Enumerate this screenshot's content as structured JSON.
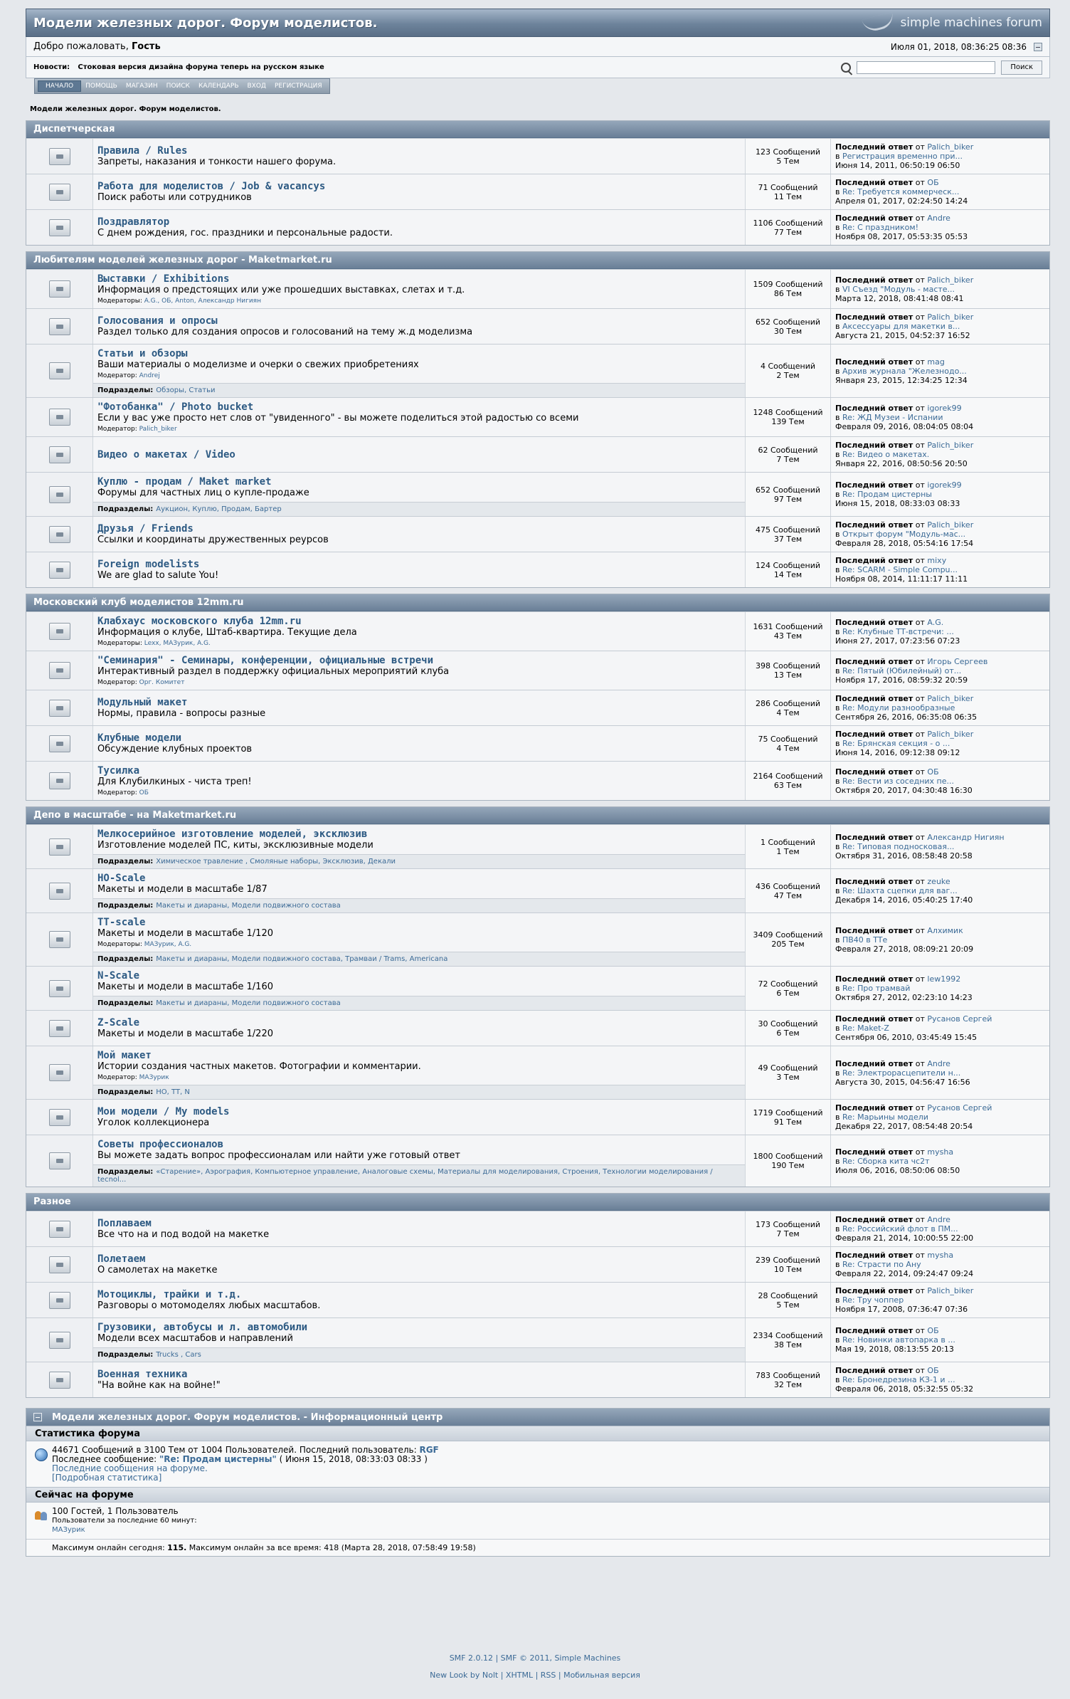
{
  "header": {
    "title": "Модели железных дорог. Форум моделистов.",
    "logo_text": "simple machines forum",
    "welcome_prefix": "Добро пожаловать,",
    "welcome_user": "Гость",
    "datetime": "Июля 01, 2018, 08:36:25 08:36",
    "news_label": "Новости:",
    "news_text": "Стоковая версия дизайна форума теперь на русском языке",
    "search_button": "Поиск",
    "menu": [
      "НАЧАЛО",
      "ПОМОЩЬ",
      "МАГАЗИН",
      "ПОИСК",
      "КАЛЕНДАРЬ",
      "ВХОД",
      "РЕГИСТРАЦИЯ"
    ],
    "breadcrumb": "Модели железных дорог. Форум моделистов."
  },
  "labels": {
    "last_post": "Последний ответ",
    "from": "от",
    "in": "в",
    "subboards": "Подразделы:"
  },
  "categories": [
    {
      "title": "Диспетчерская",
      "boards": [
        {
          "name": "Правила / Rules",
          "desc": "Запреты, наказания и тонкости нашего форума.",
          "posts": "123 Сообщений",
          "topics": "5 Тем",
          "lp_user": "Palich_biker",
          "lp_topic": "Регистрация временно при...",
          "lp_date": "Июня 14, 2011, 06:50:19 06:50",
          "mods_label": "",
          "mods": "",
          "subs": ""
        },
        {
          "name": "Работа для моделистов / Job & vacancys",
          "desc": "Поиск работы или сотрудников",
          "posts": "71 Сообщений",
          "topics": "11 Тем",
          "lp_user": "ОБ",
          "lp_topic": "Re: Требуется коммерческ...",
          "lp_date": "Апреля 01, 2017, 02:24:50 14:24",
          "mods_label": "",
          "mods": "",
          "subs": ""
        },
        {
          "name": "Поздравлятор",
          "desc": "С днем рождения, гос. праздники и персональные радости.",
          "posts": "1106 Сообщений",
          "topics": "77 Тем",
          "lp_user": "Andre",
          "lp_topic": "Re: С праздником!",
          "lp_date": "Ноября 08, 2017, 05:53:35 05:53",
          "mods_label": "",
          "mods": "",
          "subs": ""
        }
      ]
    },
    {
      "title": "Любителям моделей железных дорог - Maketmarket.ru",
      "boards": [
        {
          "name": "Выставки / Exhibitions",
          "desc": "Информация о предстоящих или уже прошедших выставках, слетах и т.д.",
          "posts": "1509 Сообщений",
          "topics": "86 Тем",
          "lp_user": "Palich_biker",
          "lp_topic": "VI Съезд \"Модуль - масте...",
          "lp_date": "Марта 12, 2018, 08:41:48 08:41",
          "mods_label": "Модераторы:",
          "mods": "A.G., ОБ, Anton, Александр Нигиян",
          "subs": ""
        },
        {
          "name": "Голосования и опросы",
          "desc": "Раздел только для создания опросов и голосований на тему ж.д моделизма",
          "posts": "652 Сообщений",
          "topics": "30 Тем",
          "lp_user": "Palich_biker",
          "lp_topic": "Аксессуары для макетки в...",
          "lp_date": "Августа 21, 2015, 04:52:37 16:52",
          "mods_label": "",
          "mods": "",
          "subs": ""
        },
        {
          "name": "Статьи и обзоры",
          "desc": "Ваши материалы о моделизме и очерки о свежих приобретениях",
          "posts": "4 Сообщений",
          "topics": "2 Тем",
          "lp_user": "mag",
          "lp_topic": "Архив журнала \"Железнодо...",
          "lp_date": "Января 23, 2015, 12:34:25 12:34",
          "mods_label": "Модератор:",
          "mods": "Andrej",
          "subs": "Обзоры, Статьи"
        },
        {
          "name": "\"Фотобанка\" / Photo bucket",
          "desc": "Если у вас уже просто нет слов от \"увиденного\" - вы можете поделиться этой радостью со всеми",
          "posts": "1248 Сообщений",
          "topics": "139 Тем",
          "lp_user": "igorek99",
          "lp_topic": "Re: ЖД Музеи - Испании",
          "lp_date": "Февраля 09, 2016, 08:04:05 08:04",
          "mods_label": "Модератор:",
          "mods": "Palich_biker",
          "subs": ""
        },
        {
          "name": "Видео о макетах / Video",
          "desc": "",
          "posts": "62 Сообщений",
          "topics": "7 Тем",
          "lp_user": "Palich_biker",
          "lp_topic": "Re: Видео о макетах.",
          "lp_date": "Января 22, 2016, 08:50:56 20:50",
          "mods_label": "",
          "mods": "",
          "subs": ""
        },
        {
          "name": "Куплю - продам / Maket market",
          "desc": "Форумы для частных лиц о купле-продаже",
          "posts": "652 Сообщений",
          "topics": "97 Тем",
          "lp_user": "igorek99",
          "lp_topic": "Re: Продам цистерны",
          "lp_date": "Июня 15, 2018, 08:33:03 08:33",
          "mods_label": "",
          "mods": "",
          "subs": "Аукцион, Куплю, Продам, Бартер"
        },
        {
          "name": "Друзья / Friends",
          "desc": "Ссылки и координаты дружественных реурсов",
          "posts": "475 Сообщений",
          "topics": "37 Тем",
          "lp_user": "Palich_biker",
          "lp_topic": "Открыт форум \"Модуль-мас...",
          "lp_date": "Февраля 28, 2018, 05:54:16 17:54",
          "mods_label": "",
          "mods": "",
          "subs": ""
        },
        {
          "name": "Foreign modelists",
          "desc": "We are glad to salute You!",
          "posts": "124 Сообщений",
          "topics": "14 Тем",
          "lp_user": "mixy",
          "lp_topic": "Re: SCARM - Simple Compu...",
          "lp_date": "Ноября 08, 2014, 11:11:17 11:11",
          "mods_label": "",
          "mods": "",
          "subs": ""
        }
      ]
    },
    {
      "title": "Московский клуб моделистов 12mm.ru",
      "boards": [
        {
          "name": "Клабхаус московского клуба 12mm.ru",
          "desc": "Информация о клубе, Штаб-квартира. Текущие дела",
          "posts": "1631 Сообщений",
          "topics": "43 Тем",
          "lp_user": "A.G.",
          "lp_topic": "Re: Клубные ТТ-встречи: ...",
          "lp_date": "Июня 27, 2017, 07:23:56 07:23",
          "mods_label": "Модераторы:",
          "mods": "Lexx, МАЗурик, A.G.",
          "subs": ""
        },
        {
          "name": "\"Семинария\" - Семинары, конференции, официальные встречи",
          "desc": "Интерактивный раздел в поддержку официальных мероприятий клуба",
          "posts": "398 Сообщений",
          "topics": "13 Тем",
          "lp_user": "Игорь Сергеев",
          "lp_topic": "Re: Пятый (Юбилейный) от...",
          "lp_date": "Ноября 17, 2016, 08:59:32 20:59",
          "mods_label": "Модератор:",
          "mods": "Орг. Комитет",
          "subs": ""
        },
        {
          "name": "Модульный макет",
          "desc": "Нормы, правила - вопросы разные",
          "posts": "286 Сообщений",
          "topics": "4 Тем",
          "lp_user": "Palich_biker",
          "lp_topic": "Re: Модули разнообразные",
          "lp_date": "Сентября 26, 2016, 06:35:08 06:35",
          "mods_label": "",
          "mods": "",
          "subs": ""
        },
        {
          "name": "Клубные модели",
          "desc": "Обсуждение клубных проектов",
          "posts": "75 Сообщений",
          "topics": "4 Тем",
          "lp_user": "Palich_biker",
          "lp_topic": "Re: Брянская секция - о ...",
          "lp_date": "Июня 14, 2016, 09:12:38 09:12",
          "mods_label": "",
          "mods": "",
          "subs": ""
        },
        {
          "name": "Тусилка",
          "desc": "Для Клубилкиных - чиста треп!",
          "posts": "2164 Сообщений",
          "topics": "63 Тем",
          "lp_user": "ОБ",
          "lp_topic": "Re: Вести из соседних пе...",
          "lp_date": "Октября 20, 2017, 04:30:48 16:30",
          "mods_label": "Модератор:",
          "mods": "ОБ",
          "subs": ""
        }
      ]
    },
    {
      "title": "Депо в масштабе - на Maketmarket.ru",
      "boards": [
        {
          "name": "Мелкосерийное изготовление моделей, эксклюзив",
          "desc": "Изготовление моделей ПС, киты, эксклюзивные модели",
          "posts": "1 Сообщений",
          "topics": "1 Тем",
          "lp_user": "Александр Нигиян",
          "lp_topic": "Re: Типовая подносковая...",
          "lp_date": "Октября 31, 2016, 08:58:48 20:58",
          "mods_label": "",
          "mods": "",
          "subs": "Химическое травление , Смоляные наборы, Эксклюзив, Декали"
        },
        {
          "name": "HO-Scale",
          "desc": "Макеты и модели в масштабе 1/87",
          "posts": "436 Сообщений",
          "topics": "47 Тем",
          "lp_user": "zeuke",
          "lp_topic": "Re: Шахта сцепки для ваг...",
          "lp_date": "Декабря 14, 2016, 05:40:25 17:40",
          "mods_label": "",
          "mods": "",
          "subs": "Макеты и диараны, Модели подвижного состава"
        },
        {
          "name": "TT-scale",
          "desc": "Макеты и модели в масштабе 1/120",
          "posts": "3409 Сообщений",
          "topics": "205 Тем",
          "lp_user": "Алхимик",
          "lp_topic": "ПВ40 в TTе",
          "lp_date": "Февраля 27, 2018, 08:09:21 20:09",
          "mods_label": "Модераторы:",
          "mods": "МАЗурик, A.G.",
          "subs": "Макеты и диараны, Модели подвижного состава, Трамваи / Trams, Americana"
        },
        {
          "name": "N-Scale",
          "desc": "Макеты и модели в масштабе 1/160",
          "posts": "72 Сообщений",
          "topics": "6 Тем",
          "lp_user": "lew1992",
          "lp_topic": "Re: Про трамвай",
          "lp_date": "Октября 27, 2012, 02:23:10 14:23",
          "mods_label": "",
          "mods": "",
          "subs": "Макеты и диараны, Модели подвижного состава"
        },
        {
          "name": "Z-Scale",
          "desc": "Макеты и модели в масштабе 1/220",
          "posts": "30 Сообщений",
          "topics": "6 Тем",
          "lp_user": "Русанов Сергей",
          "lp_topic": "Re: Maket-Z",
          "lp_date": "Сентября 06, 2010, 03:45:49 15:45",
          "mods_label": "",
          "mods": "",
          "subs": ""
        },
        {
          "name": "Мой макет",
          "desc": "Истории создания частных макетов. Фотографии и комментарии.",
          "posts": "49 Сообщений",
          "topics": "3 Тем",
          "lp_user": "Andre",
          "lp_topic": "Re: Электрорасцепители н...",
          "lp_date": "Августа 30, 2015, 04:56:47 16:56",
          "mods_label": "Модератор:",
          "mods": "МАЗурик",
          "subs": "HO, TT, N"
        },
        {
          "name": "Мои модели / My models",
          "desc": "Уголок коллекционера",
          "posts": "1719 Сообщений",
          "topics": "91 Тем",
          "lp_user": "Русанов Сергей",
          "lp_topic": "Re: Марьины модели",
          "lp_date": "Декабря 22, 2017, 08:54:48 20:54",
          "mods_label": "",
          "mods": "",
          "subs": ""
        },
        {
          "name": "Советы профессионалов",
          "desc": "Вы можете задать вопрос профессионалам или найти уже готовый ответ",
          "posts": "1800 Сообщений",
          "topics": "190 Тем",
          "lp_user": "mysha",
          "lp_topic": "Re: Сборка кита чс2т",
          "lp_date": "Июля 06, 2016, 08:50:06 08:50",
          "mods_label": "",
          "mods": "",
          "subs": "«Старение», Аэрография, Компьютерное управление, Аналоговые схемы, Материалы для моделирования, Строения, Технологии моделирования / tecnol..."
        }
      ]
    },
    {
      "title": "Разное",
      "boards": [
        {
          "name": "Поплаваем",
          "desc": "Все что на и под водой на макетке",
          "posts": "173 Сообщений",
          "topics": "7 Тем",
          "lp_user": "Andre",
          "lp_topic": "Re: Российский флот в ПМ...",
          "lp_date": "Февраля 21, 2014, 10:00:55 22:00",
          "mods_label": "",
          "mods": "",
          "subs": ""
        },
        {
          "name": "Полетаем",
          "desc": "О самолетах на макетке",
          "posts": "239 Сообщений",
          "topics": "10 Тем",
          "lp_user": "mysha",
          "lp_topic": "Re: Страсти по Ану",
          "lp_date": "Февраля 22, 2014, 09:24:47 09:24",
          "mods_label": "",
          "mods": "",
          "subs": ""
        },
        {
          "name": "Мотоциклы, трайки и т.д.",
          "desc": "Разговоры о мотомоделях любых масштабов.",
          "posts": "28 Сообщений",
          "topics": "5 Тем",
          "lp_user": "Palich_biker",
          "lp_topic": "Re: Тру чоппер",
          "lp_date": "Ноября 17, 2008, 07:36:47 07:36",
          "mods_label": "",
          "mods": "",
          "subs": ""
        },
        {
          "name": "Грузовики, автобусы и л. автомобили",
          "desc": "Модели всех масштабов и направлений",
          "posts": "2334 Сообщений",
          "topics": "38 Тем",
          "lp_user": "ОБ",
          "lp_topic": "Re: Новинки автопарка в ...",
          "lp_date": "Мая 19, 2018, 08:13:55 20:13",
          "mods_label": "",
          "mods": "",
          "subs": "Trucks , Cars"
        },
        {
          "name": "Военная техника",
          "desc": "\"На войне как на войне!\"",
          "posts": "783 Сообщений",
          "topics": "32 Тем",
          "lp_user": "ОБ",
          "lp_topic": "Re: Бронедрезина КЗ-1 и ...",
          "lp_date": "Февраля 06, 2018, 05:32:55 05:32",
          "mods_label": "",
          "mods": "",
          "subs": ""
        }
      ]
    }
  ],
  "info_center": {
    "title": "Модели железных дорог. Форум моделистов. - Информационный центр",
    "stats_title": "Статистика форума",
    "stats_line1": "44671 Сообщений в 3100 Тем от 1004 Пользователей. Последний пользователь:",
    "stats_latest_user": "RGF",
    "stats_line2_prefix": "Последнее сообщение:",
    "stats_latest_post": "\"Re: Продам цистерны\"",
    "stats_latest_date": "( Июня 15, 2018, 08:33:03 08:33 )",
    "stats_link1": "Последние сообщения на форуме.",
    "stats_link2": "[Подробная статистика]",
    "online_title": "Сейчас на форуме",
    "online_line1": "100 Гостей, 1 Пользователь",
    "online_line2": "Пользователи за последние 60 минут:",
    "online_user": "МАЗурик",
    "max_prefix": "Максимум онлайн сегодня:",
    "max_today": "115.",
    "max_rest": "Максимум онлайн за все время: 418 (Марта 28, 2018, 07:58:49 19:58)"
  },
  "footer": {
    "line1": "SMF 2.0.12 | SMF © 2011, Simple Machines",
    "line2": "New Look by Nolt | XHTML | RSS | Мобильная версия"
  }
}
